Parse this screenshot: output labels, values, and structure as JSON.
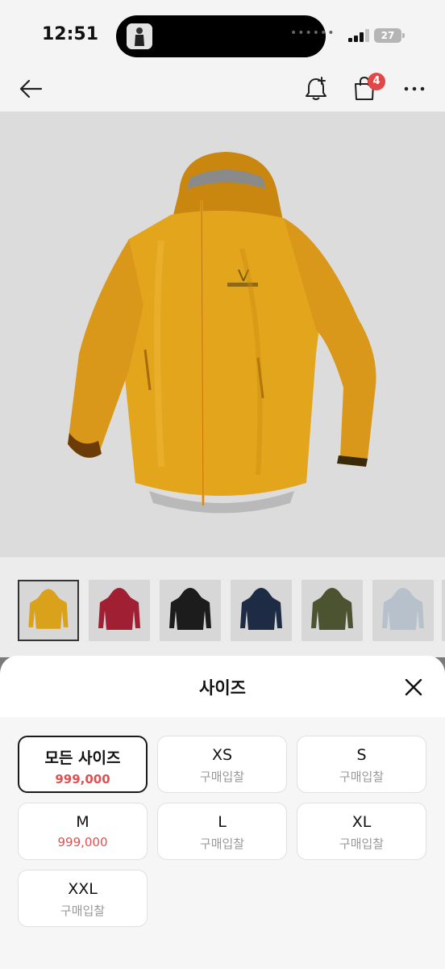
{
  "status_bar": {
    "time": "12:51",
    "battery": "27"
  },
  "nav": {
    "cart_badge": "4"
  },
  "sheet": {
    "title": "사이즈",
    "options": [
      {
        "size": "모든 사이즈",
        "sub": "999,000",
        "state": "selected",
        "sub_type": "price"
      },
      {
        "size": "XS",
        "sub": "구매입찰",
        "state": "default",
        "sub_type": "bid"
      },
      {
        "size": "S",
        "sub": "구매입찰",
        "state": "default",
        "sub_type": "bid"
      },
      {
        "size": "M",
        "sub": "999,000",
        "state": "default",
        "sub_type": "price"
      },
      {
        "size": "L",
        "sub": "구매입찰",
        "state": "default",
        "sub_type": "bid"
      },
      {
        "size": "XL",
        "sub": "구매입찰",
        "state": "default",
        "sub_type": "bid"
      },
      {
        "size": "XXL",
        "sub": "구매입찰",
        "state": "default",
        "sub_type": "bid"
      }
    ]
  },
  "thumbnails": {
    "colors": [
      "#d9a21a",
      "#a11f32",
      "#1c1c1c",
      "#1e2b45",
      "#4b5330",
      "#b7c1cc"
    ],
    "selected_index": 0
  },
  "colors": {
    "price_red": "#e05050",
    "badge_red": "#e04848",
    "jacket_yellow": "#e3a51c"
  }
}
